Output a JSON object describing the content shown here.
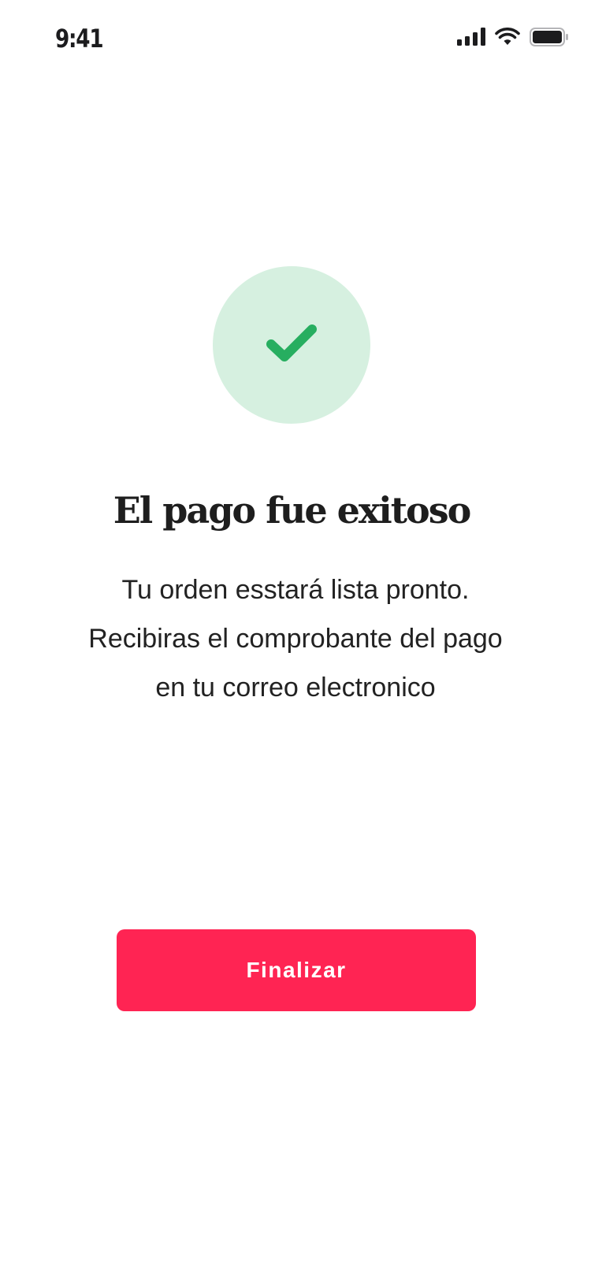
{
  "status_bar": {
    "time": "9:41",
    "icons": [
      "cellular-signal-icon",
      "wifi-icon",
      "battery-icon"
    ]
  },
  "success": {
    "icon": "checkmark-icon",
    "circle_color": "#d6f0e0",
    "check_color": "#27ae60"
  },
  "title": "El pago fue exitoso",
  "message": {
    "line1": "Tu orden esstará lista pronto.",
    "line2": "Recibiras el comprobante del pago",
    "line3": "en tu correo electronico"
  },
  "actions": {
    "finish_label": "Finalizar",
    "button_color": "#ff2453"
  }
}
